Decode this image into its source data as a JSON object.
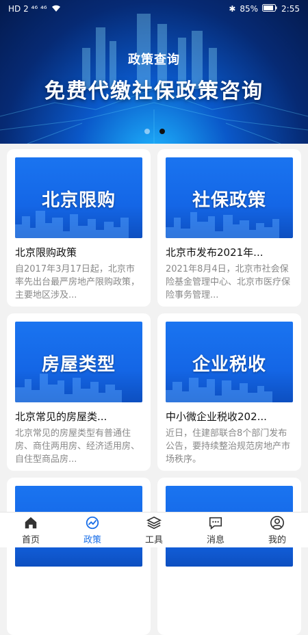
{
  "status_bar": {
    "left": "HD 2 ⁴⁶ ⁴⁶",
    "battery": "85%",
    "time": "2:55"
  },
  "banner": {
    "subtitle": "政策查询",
    "title": "免费代缴社保政策咨询",
    "slide_count": 2,
    "active_slide": 2
  },
  "cards": [
    {
      "image_text": "北京限购",
      "title": "北京限购政策",
      "desc": "自2017年3月17日起，北京市率先出台最严房地产限购政策，主要地区涉及..."
    },
    {
      "image_text": "社保政策",
      "title": "北京市发布2021年...",
      "desc": "2021年8月4日，北京市社会保险基金管理中心、北京市医疗保险事务管理..."
    },
    {
      "image_text": "房屋类型",
      "title": "北京常见的房屋类...",
      "desc": "北京常见的房屋类型有普通住房、商住两用房、经济适用房、自住型商品房..."
    },
    {
      "image_text": "企业税收",
      "title": "中小微企业税收202...",
      "desc": "近日，住建部联合8个部门发布公告，要持续整治规范房地产市场秩序。"
    }
  ],
  "tabbar": {
    "items": [
      {
        "label": "首页",
        "icon": "home-icon"
      },
      {
        "label": "政策",
        "icon": "policy-chart-icon"
      },
      {
        "label": "工具",
        "icon": "layers-icon"
      },
      {
        "label": "消息",
        "icon": "message-icon"
      },
      {
        "label": "我的",
        "icon": "user-icon"
      }
    ],
    "active_index": 1,
    "active_color": "#1a6fe8"
  }
}
